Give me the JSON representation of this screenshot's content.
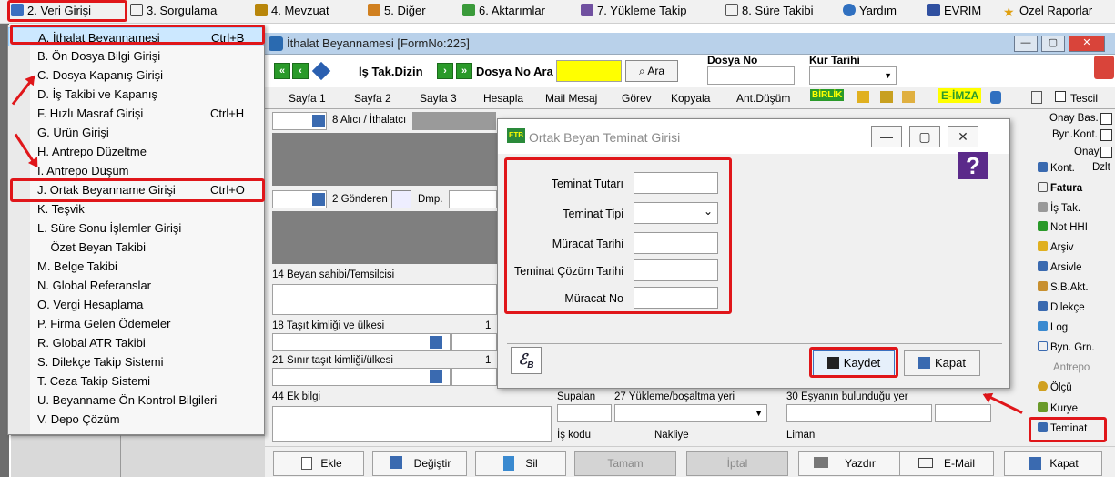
{
  "menubar": {
    "items": [
      {
        "label": "2.  Veri Girişi",
        "color": "#3b6fc0"
      },
      {
        "label": "3.  Sorgulama",
        "color": "#444"
      },
      {
        "label": "4.  Mevzuat",
        "color": "#b8860b"
      },
      {
        "label": "5.  Diğer",
        "color": "#d08020"
      },
      {
        "label": "6.  Aktarımlar",
        "color": "#3a9a3a"
      },
      {
        "label": "7.  Yükleme Takip",
        "color": "#7050a0"
      },
      {
        "label": "8. Süre Takibi",
        "color": "#555"
      },
      {
        "label": "Yardım",
        "color": "#3070c0"
      },
      {
        "label": "EVRIM",
        "color": "#3050a0"
      },
      {
        "label": "Özel Raporlar",
        "color": "#e0a010"
      }
    ]
  },
  "dropdown": {
    "items": [
      {
        "label": "A.  İthalat Beyannamesi",
        "shortcut": "Ctrl+B"
      },
      {
        "label": "B.  Ön Dosya Bilgi Girişi",
        "shortcut": ""
      },
      {
        "label": "C.  Dosya Kapanış Girişi",
        "shortcut": ""
      },
      {
        "label": "D.  İş Takibi ve Kapanış",
        "shortcut": ""
      },
      {
        "label": "F.  Hızlı Masraf Girişi",
        "shortcut": "Ctrl+H"
      },
      {
        "label": "G.  Ürün Girişi",
        "shortcut": ""
      },
      {
        "label": "H.  Antrepo Düzeltme",
        "shortcut": ""
      },
      {
        "label": "I.   Antrepo Düşüm",
        "shortcut": ""
      },
      {
        "label": "J.  Ortak Beyanname Girişi",
        "shortcut": "Ctrl+O"
      },
      {
        "label": "K.  Teşvik",
        "shortcut": ""
      },
      {
        "label": "L.  Süre Sonu İşlemler Girişi",
        "shortcut": ""
      },
      {
        "label": "    Özet Beyan Takibi",
        "shortcut": ""
      },
      {
        "label": "M.  Belge Takibi",
        "shortcut": ""
      },
      {
        "label": "N.  Global Referanslar",
        "shortcut": ""
      },
      {
        "label": "O. Vergi Hesaplama",
        "shortcut": ""
      },
      {
        "label": "P. Firma Gelen Ödemeler",
        "shortcut": ""
      },
      {
        "label": "R. Global ATR Takibi",
        "shortcut": ""
      },
      {
        "label": "S. Dilekçe Takip Sistemi",
        "shortcut": ""
      },
      {
        "label": "T. Ceza Takip Sistemi",
        "shortcut": ""
      },
      {
        "label": "U. Beyanname Ön Kontrol Bilgileri",
        "shortcut": ""
      },
      {
        "label": "V. Depo Çözüm",
        "shortcut": ""
      }
    ]
  },
  "window": {
    "title": "İthalat Beyannamesi [FormNo:225]",
    "minimize": "—",
    "restore": "▢",
    "close": "✕"
  },
  "toolbar": {
    "is_tak_dizin": "İş Tak.Dizin",
    "dosya_no_ara": "Dosya No Ara",
    "ara_button": "Ara",
    "dosya_no_label": "Dosya No",
    "kur_tarihi_label": "Kur Tarihi",
    "nav_first": "«",
    "nav_prev": "‹",
    "nav_next": "›",
    "nav_last": "»"
  },
  "tabs": {
    "items": [
      "Sayfa 1",
      "Sayfa 2",
      "Sayfa 3",
      "Hesapla",
      "Mail Mesaj",
      "Görev",
      "Kopyala",
      "Ant.Düşüm",
      "BİRLİK",
      "E-İMZA",
      "Tescil"
    ]
  },
  "form": {
    "alici": "8 Alıcı / İthalatcı",
    "gonderen": "2 Gönderen",
    "dmp": "Dmp.",
    "beyan_sahibi": "14 Beyan sahibi/Temsilcisi",
    "tasit": "18 Taşıt kimliği ve ülkesi",
    "sinir_tasit": "21 Sınır taşıt kimliği/ülkesi",
    "ek_bilgi": "44 Ek bilgi",
    "supalan": "Supalan",
    "yukleme": "27 Yükleme/boşaltma yeri",
    "esya_yeri": "30 Eşyanın bulunduğu yer",
    "is_kodu": "İş kodu",
    "nakliye": "Nakliye",
    "liman": "Liman",
    "one": "1",
    "t1": "1",
    "t2": "1"
  },
  "right_panel": {
    "onay_bas": "Onay Bas.",
    "byn_kont": "Byn.Kont.",
    "onay": "Onay",
    "kont": "Kont.",
    "dzlt": "Dzlt",
    "items": [
      "Fatura",
      "İş Tak.",
      "Not HHI",
      "Arşiv",
      "Arsivle",
      "S.B.Akt.",
      "Dilekçe",
      "Log",
      "Byn. Grn.",
      "Antrepo",
      "Ölçü",
      "Kurye",
      "Teminat"
    ]
  },
  "bottom": {
    "ekle": "Ekle",
    "degistir": "Değiştir",
    "sil": "Sil",
    "tamam": "Tamam",
    "iptal": "İptal",
    "yazdir": "Yazdır",
    "email": "E-Mail",
    "kapat": "Kapat"
  },
  "dialog": {
    "title": "Ortak Beyan Teminat Girisi",
    "fields": [
      "Teminat Tutarı",
      "Teminat Tipi",
      "Müracat Tarihi",
      "Teminat Çözüm Tarihi",
      "Müracat No"
    ],
    "kaydet": "Kaydet",
    "kapat": "Kapat",
    "minimize": "—",
    "restore": "▢",
    "close": "✕",
    "help": "?"
  }
}
